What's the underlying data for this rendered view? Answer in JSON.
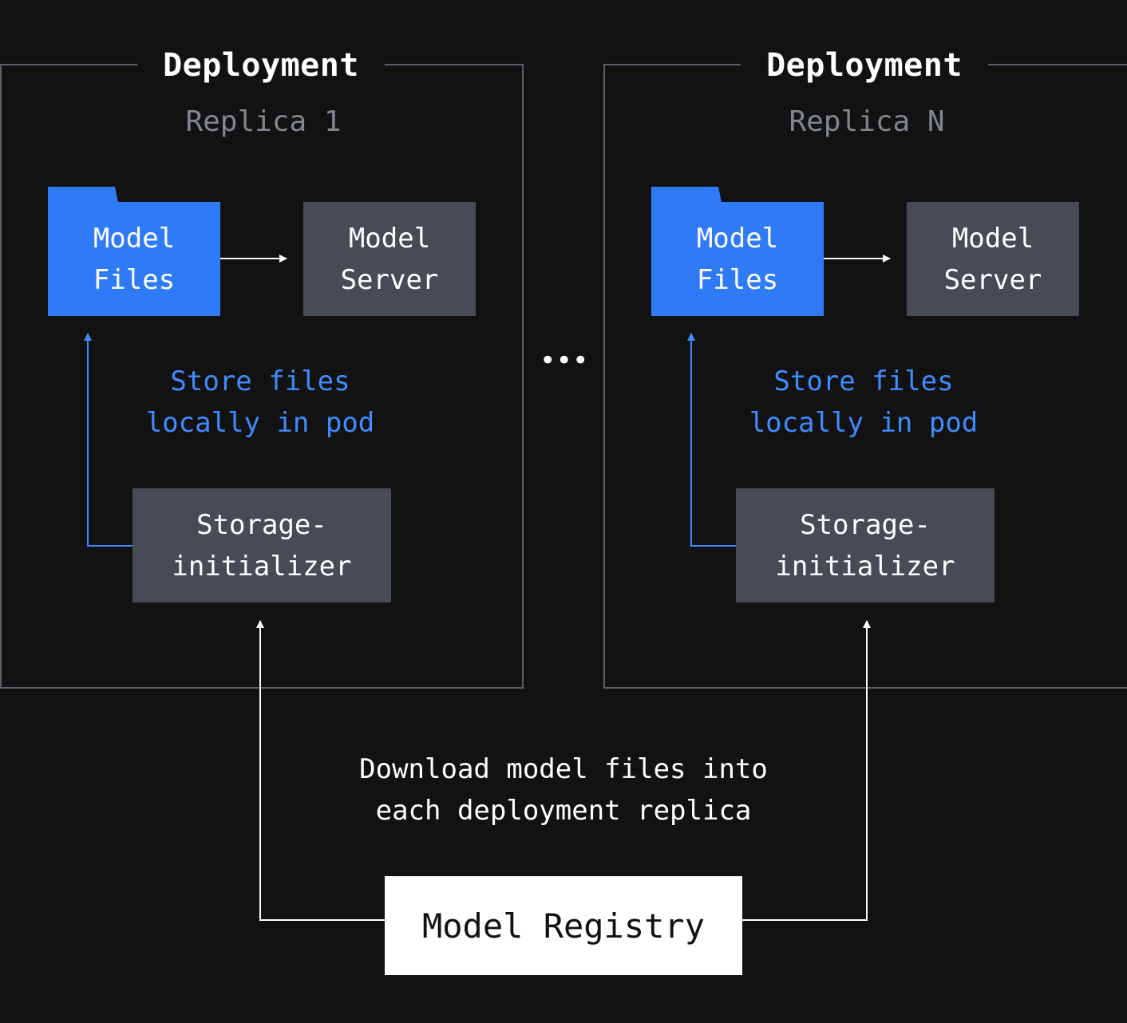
{
  "colors": {
    "background": "#121212",
    "frame_border": "#5a616b",
    "model_files": "#2f7bf7",
    "gray_box": "#464b55",
    "blue_text": "#3f8cff",
    "replica_label": "#7f868f",
    "registry": "#ffffff"
  },
  "deployments": [
    {
      "title": "Deployment",
      "replica": "Replica 1",
      "model_files": [
        "Model",
        "Files"
      ],
      "model_server": [
        "Model",
        "Server"
      ],
      "note": [
        "Store files",
        "locally in pod"
      ],
      "initializer": [
        "Storage-",
        "initializer"
      ]
    },
    {
      "title": "Deployment",
      "replica": "Replica N",
      "model_files": [
        "Model",
        "Files"
      ],
      "model_server": [
        "Model",
        "Server"
      ],
      "note": [
        "Store files",
        "locally in pod"
      ],
      "initializer": [
        "Storage-",
        "initializer"
      ]
    }
  ],
  "ellipsis": "•••",
  "caption": [
    "Download model files into",
    "each deployment replica"
  ],
  "registry": "Model Registry",
  "icons": [
    "folder-icon"
  ]
}
